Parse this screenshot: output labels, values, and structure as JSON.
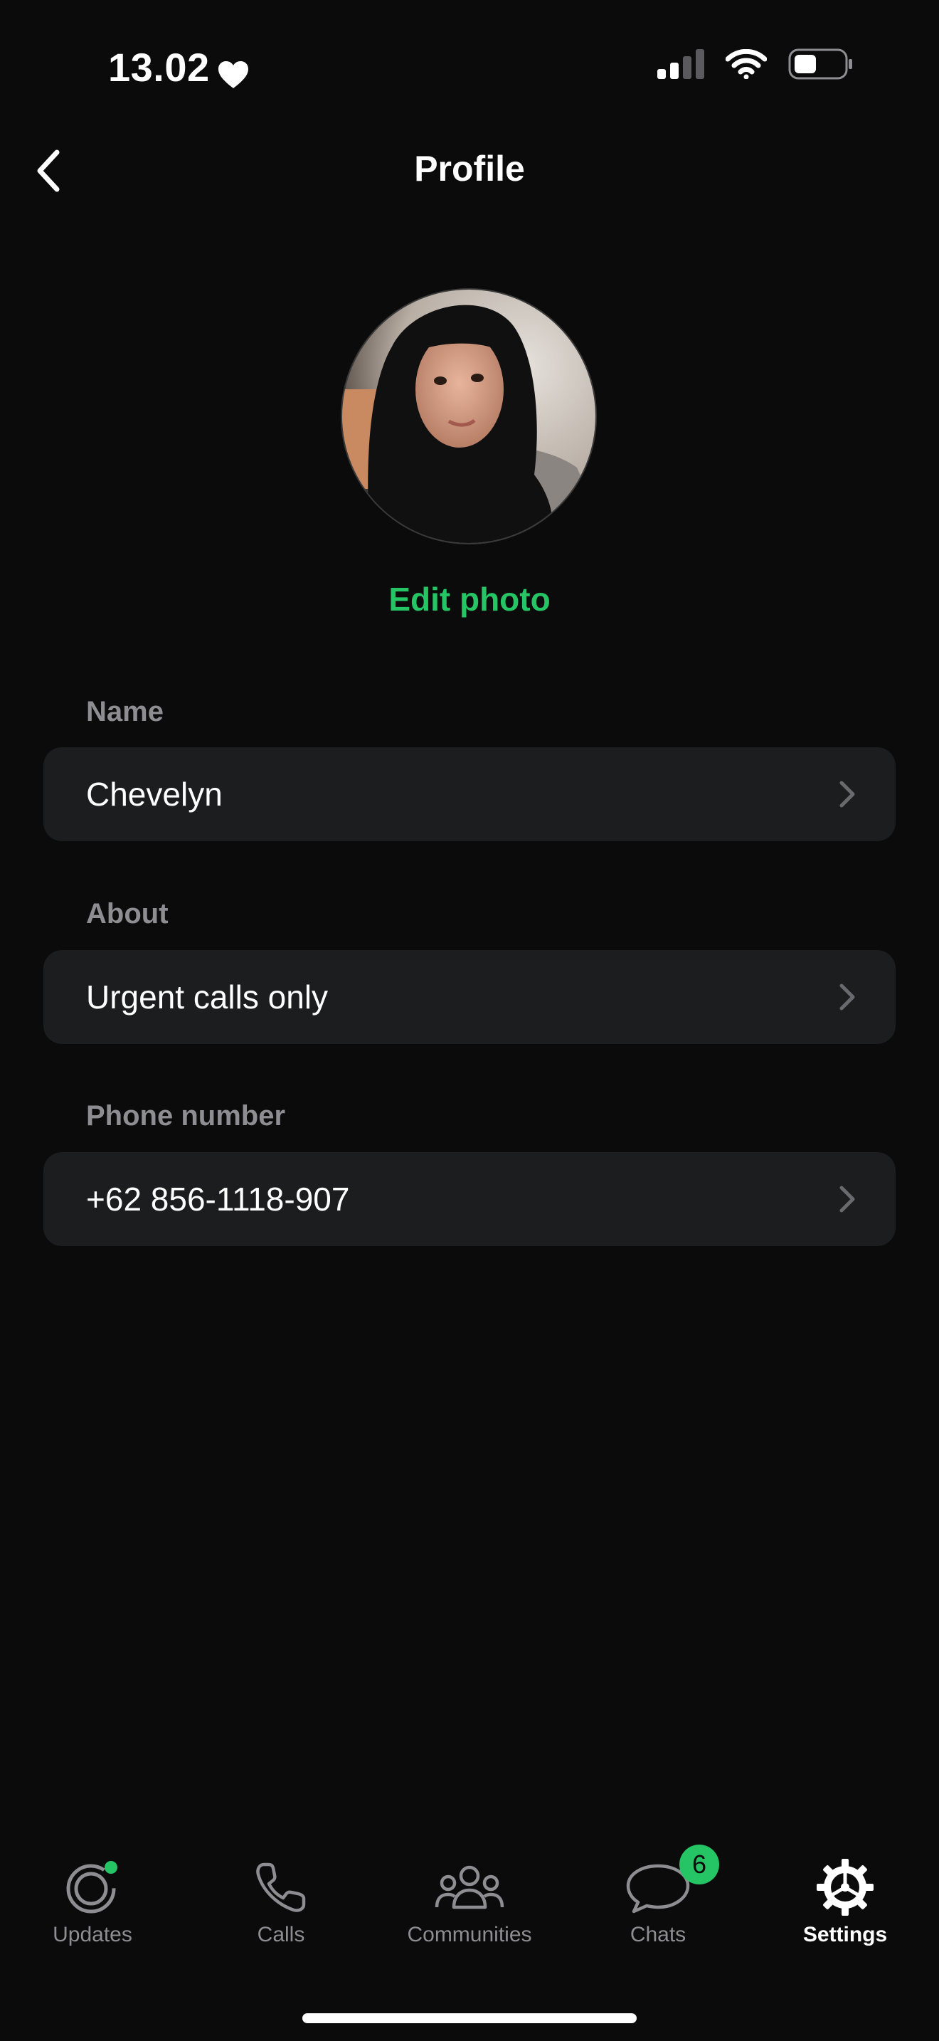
{
  "status_bar": {
    "time": "13.02"
  },
  "header": {
    "title": "Profile"
  },
  "profile": {
    "edit_photo_label": "Edit photo"
  },
  "fields": [
    {
      "label": "Name",
      "value": "Chevelyn"
    },
    {
      "label": "About",
      "value": "Urgent calls only"
    },
    {
      "label": "Phone number",
      "value": "+62 856-1118-907"
    }
  ],
  "tabs": [
    {
      "label": "Updates",
      "icon": "updates-icon",
      "dot": true
    },
    {
      "label": "Calls",
      "icon": "phone-icon"
    },
    {
      "label": "Communities",
      "icon": "communities-icon"
    },
    {
      "label": "Chats",
      "icon": "chats-icon",
      "badge": "6"
    },
    {
      "label": "Settings",
      "icon": "gear-icon",
      "active": true
    }
  ],
  "colors": {
    "accent": "#25c565",
    "background": "#0b0b0b",
    "card": "#1c1d1e",
    "secondary_text": "#8d8d92"
  }
}
